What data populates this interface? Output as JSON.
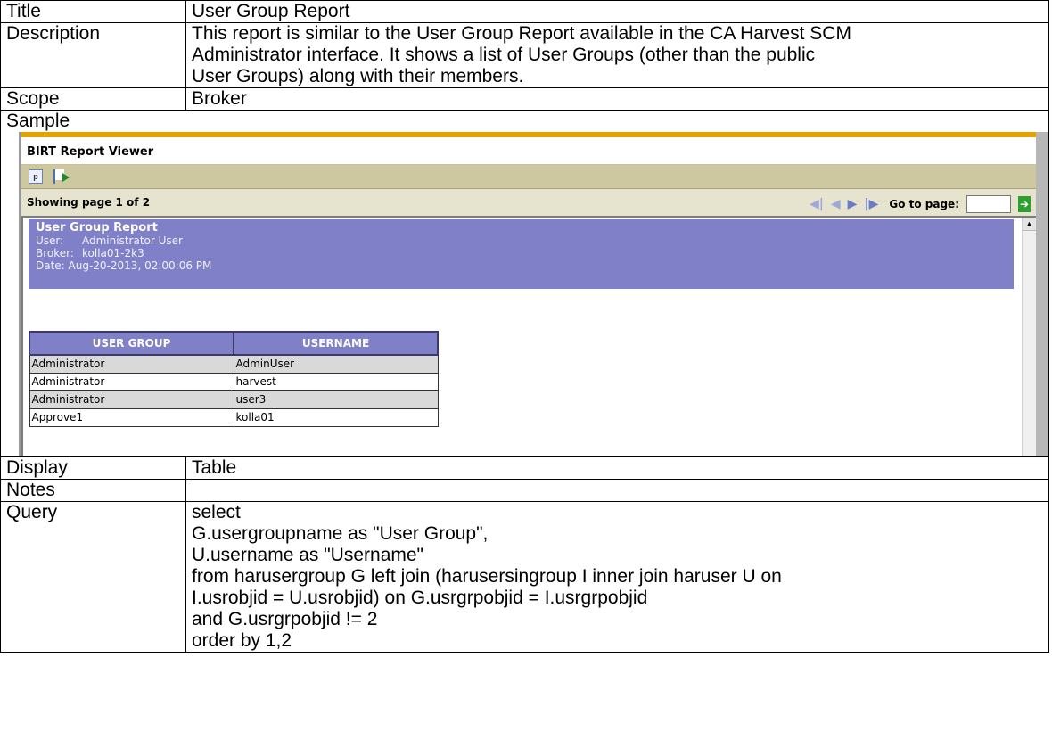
{
  "rows": {
    "title": {
      "label": "Title",
      "value": "User Group Report"
    },
    "description": {
      "label": "Description",
      "lines": [
        "This report is similar to the User Group Report available in the CA Harvest SCM",
        "Administrator interface.  It shows a list of User Groups (other than the public",
        "User Groups) along with their members."
      ]
    },
    "scope": {
      "label": "Scope",
      "value": "Broker"
    },
    "sample": {
      "label": "Sample"
    },
    "display": {
      "label": "Display",
      "value": "Table"
    },
    "notes": {
      "label": "Notes",
      "value": ""
    },
    "query": {
      "label": "Query",
      "lines": [
        "select",
        "G.usergroupname as \"User Group\",",
        "U.username as \"Username\"",
        "from harusergroup G left join (harusersingroup I inner join haruser U on",
        "I.usrobjid = U.usrobjid) on G.usrgrpobjid = I.usrgrpobjid",
        "and G.usrgrpobjid != 2",
        "order by 1,2"
      ]
    }
  },
  "viewer": {
    "title": "BIRT Report Viewer",
    "page_status": "Showing page  1  of  2",
    "goto_label": "Go to page:",
    "goto_value": "",
    "report": {
      "title": "User Group Report",
      "user_key": "User:",
      "user_value": "Administrator User",
      "broker_key": "Broker:",
      "broker_value": "kolla01-2k3",
      "date_line": "Date: Aug-20-2013, 02:00:06 PM"
    },
    "table": {
      "headers": [
        "USER GROUP",
        "USERNAME"
      ],
      "rows": [
        [
          "Administrator",
          "AdminUser"
        ],
        [
          "Administrator",
          "harvest"
        ],
        [
          "Administrator",
          "user3"
        ],
        [
          "Approve1",
          "kolla01"
        ]
      ]
    }
  },
  "colors": {
    "accent_bar": "#e2a200",
    "report_header": "#8080c8",
    "toolbar": "#cec8a0"
  },
  "icons": [
    "pdf-icon",
    "export-icon",
    "first-page-icon",
    "previous-page-icon",
    "next-page-icon",
    "last-page-icon",
    "go-icon"
  ]
}
